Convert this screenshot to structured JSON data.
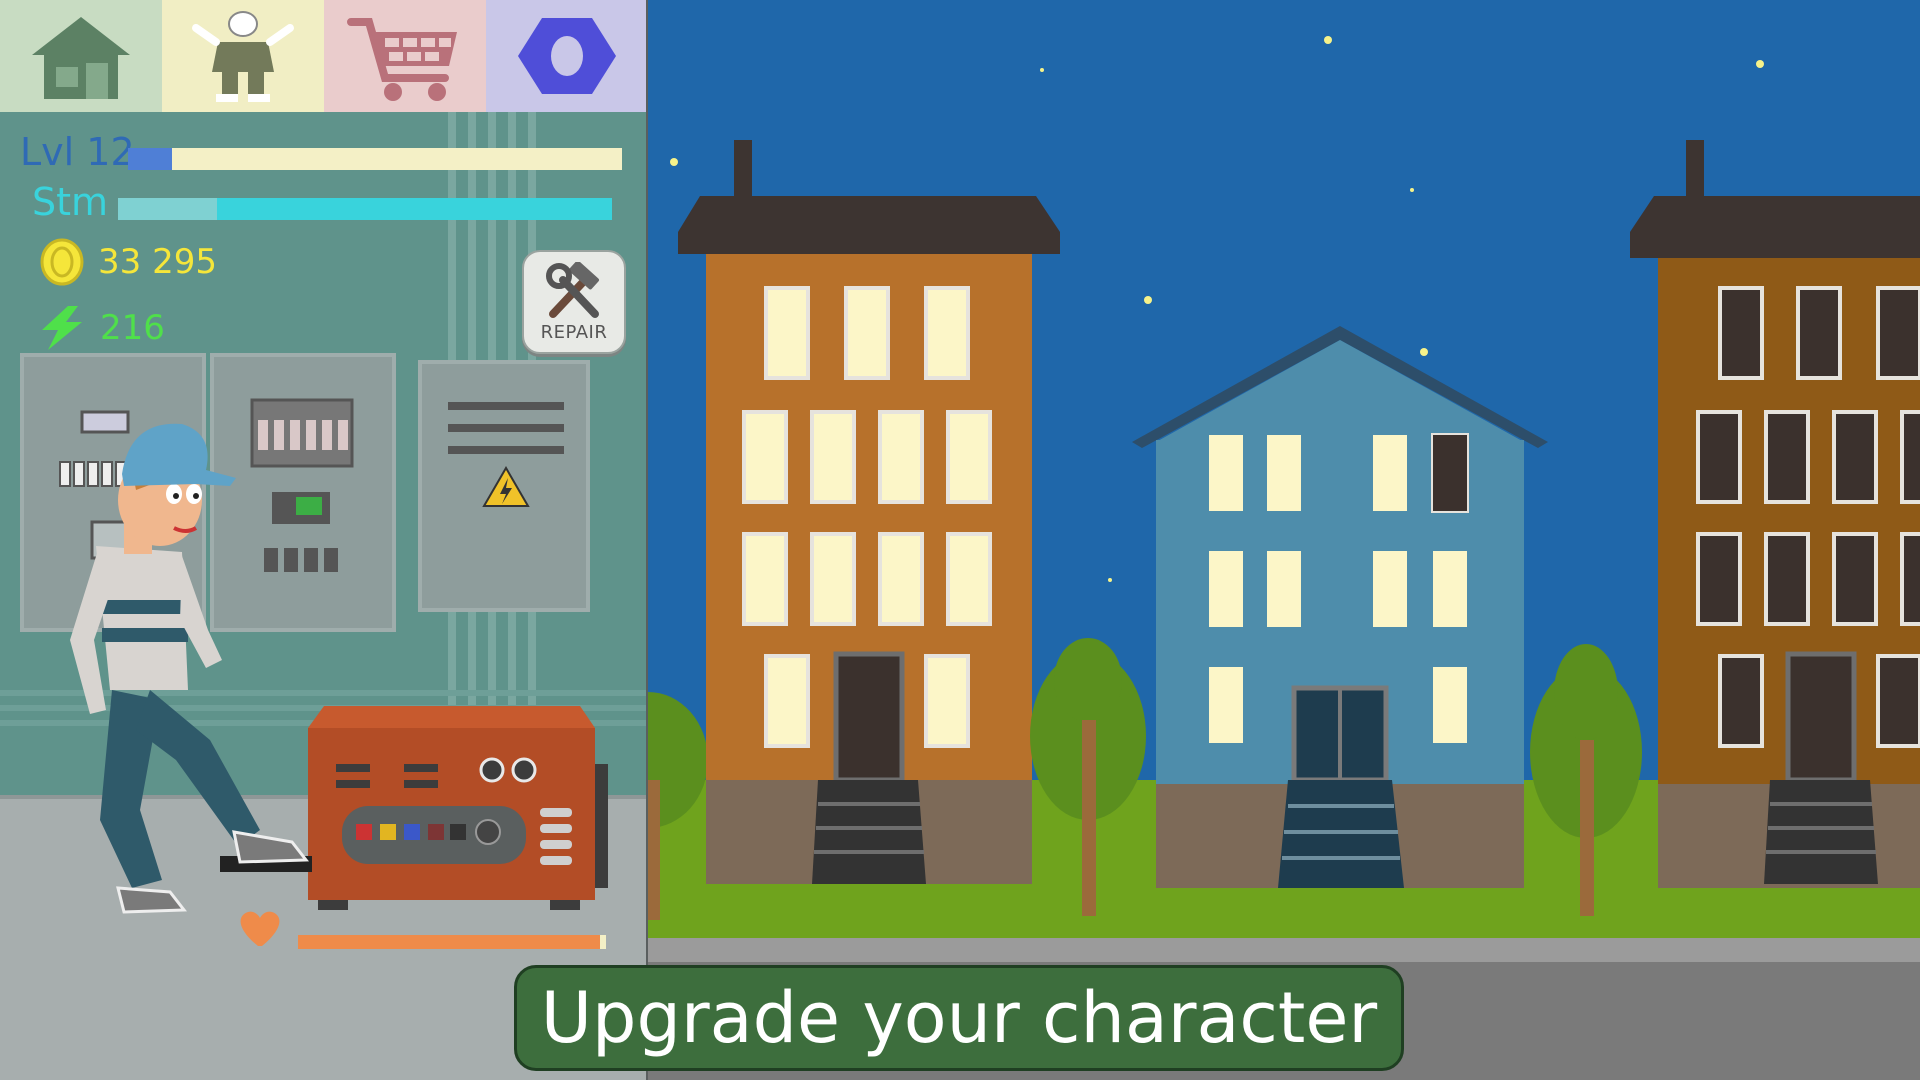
{
  "nav": [
    {
      "id": "home",
      "icon": "home-icon",
      "bg": "#c8dcc2"
    },
    {
      "id": "character",
      "icon": "character-icon",
      "bg": "#f1eec4"
    },
    {
      "id": "shop",
      "icon": "shop-cart-icon",
      "bg": "#eacccc"
    },
    {
      "id": "settings",
      "icon": "hex-nut-icon",
      "bg": "#c9c7e8"
    }
  ],
  "stats": {
    "level_label": "Lvl 12",
    "level_progress": 0.09,
    "stamina_label": "Stm",
    "stamina_progress": 0.2,
    "coins": "33 295",
    "energy": "216"
  },
  "repair": {
    "label": "REPAIR",
    "icon": "hammer-wrench-icon"
  },
  "health": {
    "icon": "heart-icon",
    "progress": 0.98
  },
  "banner": {
    "text": "Upgrade your character"
  },
  "colors": {
    "level": "#2f6ab5",
    "level_fill": "#4f7fd6",
    "stamina": "#39d3dc",
    "coins": "#f5e63a",
    "energy": "#4fe04a",
    "sky": "#1f67aa",
    "grass": "#6fa31d",
    "banner_bg": "#3d6e3d"
  }
}
